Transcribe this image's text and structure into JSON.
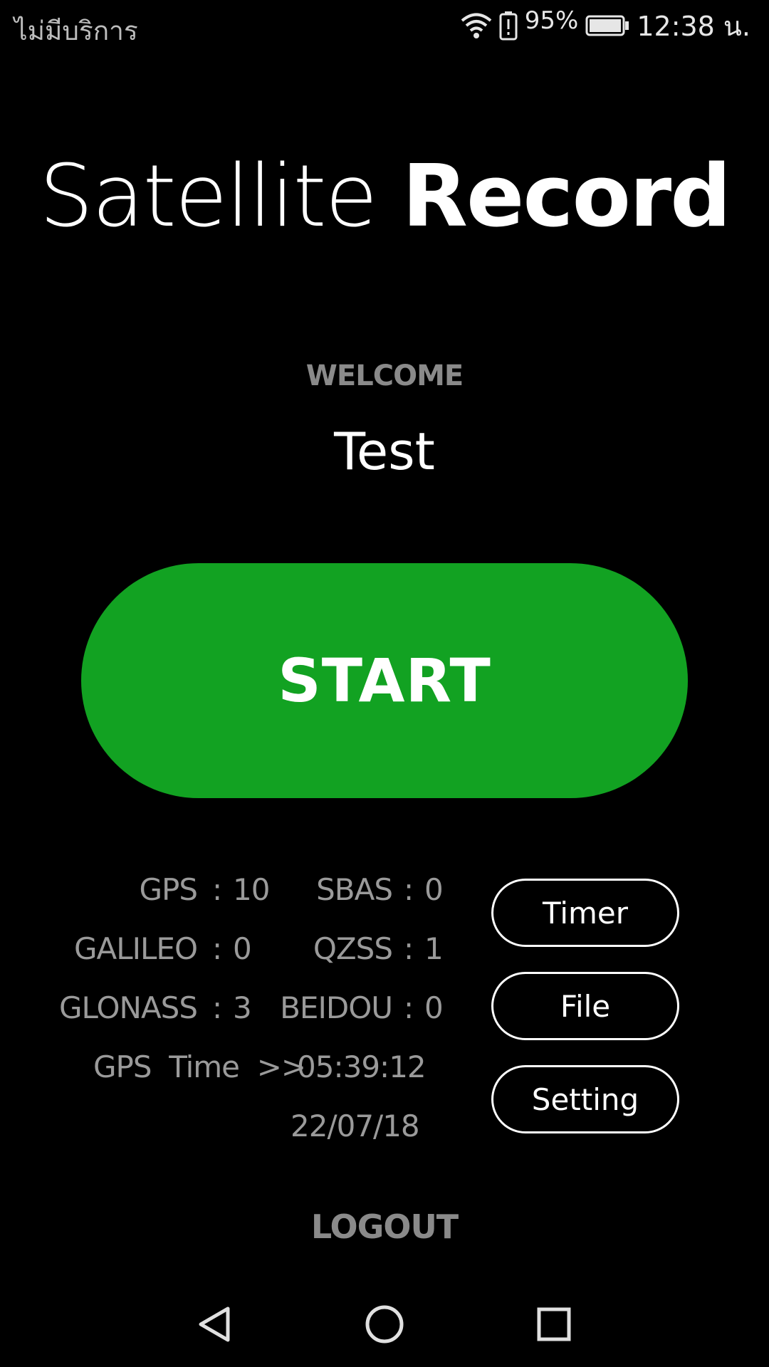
{
  "status_bar": {
    "carrier": "ไม่มีบริการ",
    "battery_percent": "95%",
    "time": "12:38 น.",
    "icons": [
      "wifi-icon",
      "battery-alert-icon",
      "battery-icon"
    ]
  },
  "title": {
    "light": "Satellite",
    "bold": "Record"
  },
  "welcome_label": "WELCOME",
  "username": "Test",
  "start_label": "START",
  "stats": {
    "gps": {
      "label": "GPS",
      "sep": ":",
      "value": "10"
    },
    "galileo": {
      "label": "GALILEO",
      "sep": ":",
      "value": "0"
    },
    "glonass": {
      "label": "GLONASS",
      "sep": ":",
      "value": "3"
    },
    "sbas": {
      "label": "SBAS",
      "sep": ":",
      "value": "0"
    },
    "qzss": {
      "label": "QZSS",
      "sep": ":",
      "value": "1"
    },
    "beidou": {
      "label": "BEIDOU",
      "sep": ":",
      "value": "0"
    },
    "gps_time_label": "GPS  Time  >>",
    "gps_time": "05:39:12",
    "gps_date": "22/07/18"
  },
  "buttons": {
    "timer": "Timer",
    "file": "File",
    "setting": "Setting"
  },
  "logout_label": "LOGOUT",
  "nav": [
    "back-icon",
    "home-icon",
    "recents-icon"
  ],
  "colors": {
    "background": "#000000",
    "start_green": "#12a222",
    "muted_text": "#9a9a9a"
  }
}
